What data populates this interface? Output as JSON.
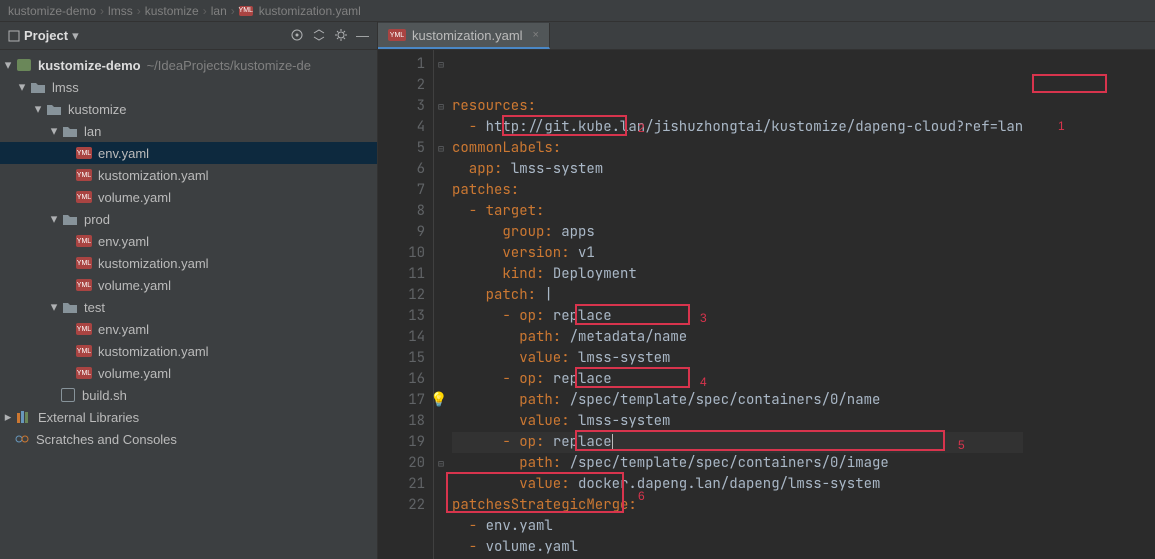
{
  "breadcrumb": [
    "kustomize-demo",
    "lmss",
    "kustomize",
    "lan",
    "kustomization.yaml"
  ],
  "sidebar": {
    "title": "Project",
    "root": {
      "name": "kustomize-demo",
      "path": "~/IdeaProjects/kustomize-de"
    },
    "tree": {
      "lmss": "lmss",
      "kustomize": "kustomize",
      "lan": "lan",
      "prod": "prod",
      "test": "test",
      "env": "env.yaml",
      "kust": "kustomization.yaml",
      "vol": "volume.yaml",
      "build": "build.sh",
      "ext": "External Libraries",
      "scr": "Scratches and Consoles"
    }
  },
  "tab": {
    "label": "kustomization.yaml"
  },
  "code": {
    "l1": "resources:",
    "l2_a": "  - ",
    "l2_b": "http://git.kube.lan/jishuzhongtai/kustomize/dapeng-cloud?ref=lan",
    "l3": "commonLabels:",
    "l4_a": "  app: ",
    "l4_b": "lmss-system",
    "l5": "patches:",
    "l6_a": "  - ",
    "l6_b": "target:",
    "l7_a": "      group: ",
    "l7_b": "apps",
    "l8_a": "      version: ",
    "l8_b": "v1",
    "l9_a": "      kind: ",
    "l9_b": "Deployment",
    "l10_a": "    patch: ",
    "l10_b": "|",
    "l11_a": "      - ",
    "l11_b": "op: ",
    "l11_c": "replace",
    "l12_a": "        path: ",
    "l12_b": "/metadata/name",
    "l13_a": "        value: ",
    "l13_b": "lmss-system",
    "l14_a": "      - ",
    "l14_b": "op: ",
    "l14_c": "replace",
    "l15_a": "        path: ",
    "l15_b": "/spec/template/spec/containers/0/name",
    "l16_a": "        value: ",
    "l16_b": "lmss-system",
    "l17_a": "      - ",
    "l17_b": "op: ",
    "l17_c": "replace",
    "l18_a": "        path: ",
    "l18_b": "/spec/template/spec/containers/0/image",
    "l19_a": "        value: ",
    "l19_b": "docker.dapeng.lan/dapeng/lmss-system",
    "l20": "patchesStrategicMerge:",
    "l21_a": "  - ",
    "l21_b": "env.yaml",
    "l22_a": "  - ",
    "l22_b": "volume.yaml"
  },
  "annotations": {
    "a1": "1",
    "a2": "2",
    "a3": "3",
    "a4": "4",
    "a5": "5",
    "a6": "6"
  }
}
